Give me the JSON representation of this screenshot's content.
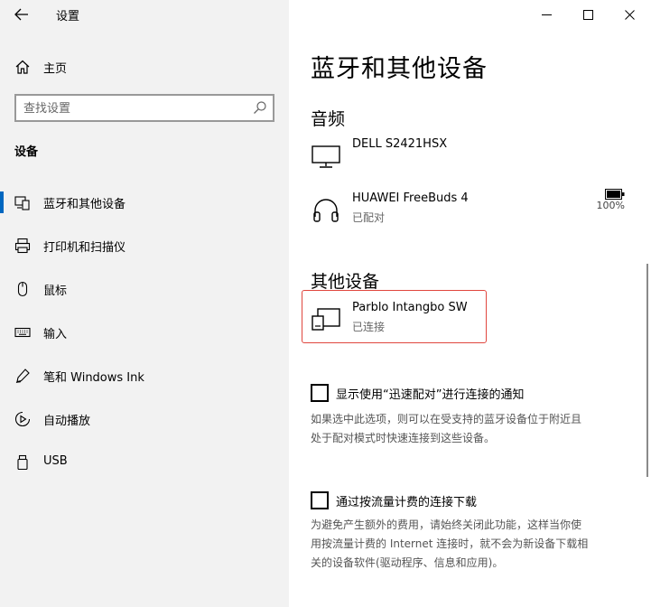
{
  "window": {
    "title": "设置",
    "minimize_icon": "minimize-icon",
    "maximize_icon": "maximize-icon",
    "close_icon": "close-icon"
  },
  "sidebar": {
    "home_label": "主页",
    "search_placeholder": "查找设置",
    "section_title": "设备",
    "items": [
      {
        "label": "蓝牙和其他设备",
        "icon": "bluetooth-devices-icon",
        "selected": true
      },
      {
        "label": "打印机和扫描仪",
        "icon": "printer-icon"
      },
      {
        "label": "鼠标",
        "icon": "mouse-icon"
      },
      {
        "label": "输入",
        "icon": "keyboard-icon"
      },
      {
        "label": "笔和 Windows Ink",
        "icon": "pen-icon"
      },
      {
        "label": "自动播放",
        "icon": "autoplay-icon"
      },
      {
        "label": "USB",
        "icon": "usb-icon"
      }
    ],
    "accent_color": "#0067c0"
  },
  "main": {
    "page_title": "蓝牙和其他设备",
    "audio": {
      "title": "音频",
      "devices": [
        {
          "name": "DELL S2421HSX",
          "status": "",
          "icon": "monitor-icon"
        },
        {
          "name": "HUAWEI FreeBuds 4",
          "status": "已配对",
          "icon": "headphones-icon",
          "battery": "100%",
          "battery_icon": "battery-full-icon"
        }
      ]
    },
    "other": {
      "title": "其他设备",
      "devices": [
        {
          "name": "Parblo Intangbo SW",
          "status": "已连接",
          "icon": "tablet-device-icon"
        }
      ],
      "highlight_color": "#e0463e"
    },
    "swift_pair": {
      "label": "显示使用“迅速配对”进行连接的通知",
      "checked": false,
      "desc_line1": "如果选中此选项，则可以在受支持的蓝牙设备位于附近且",
      "desc_line2": "处于配对模式时快速连接到这些设备。"
    },
    "metered": {
      "label": "通过按流量计费的连接下载",
      "checked": false,
      "desc_line1": "为避免产生额外的费用，请始终关闭此功能，这样当你使",
      "desc_line2": "用按流量计费的 Internet 连接时，就不会为新设备下载相",
      "desc_line3": "关的设备软件(驱动程序、信息和应用)。"
    }
  }
}
